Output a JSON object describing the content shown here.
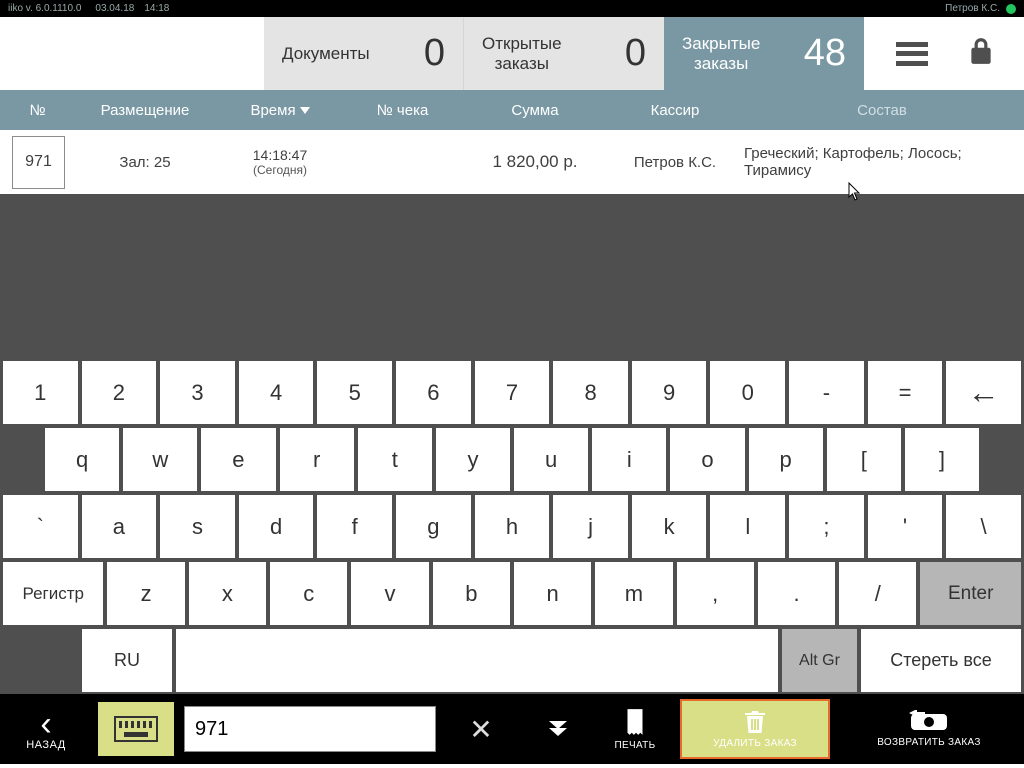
{
  "status": {
    "app": "iiko  v. 6.0.1110.0",
    "date": "03.04.18",
    "time": "14:18",
    "user": "Петров К.С."
  },
  "tabs": {
    "documents": {
      "label": "Документы",
      "count": "0"
    },
    "open": {
      "label": "Открытые\nзаказы",
      "count": "0"
    },
    "closed": {
      "label": "Закрытые\nзаказы",
      "count": "48"
    }
  },
  "columns": {
    "no": "№",
    "place": "Размещение",
    "time": "Время",
    "check": "№ чека",
    "sum": "Сумма",
    "cashier": "Кассир",
    "comp": "Состав"
  },
  "row": {
    "no": "971",
    "place": "Зал: 25",
    "time": "14:18:47",
    "time_sub": "(Сегодня)",
    "sum": "1 820,00 р.",
    "cashier": "Петров К.С.",
    "comp": "Греческий; Картофель; Лосось; Тирамису"
  },
  "keyboard": {
    "row1": [
      "1",
      "2",
      "3",
      "4",
      "5",
      "6",
      "7",
      "8",
      "9",
      "0",
      "-",
      "="
    ],
    "row2": [
      "q",
      "w",
      "e",
      "r",
      "t",
      "y",
      "u",
      "i",
      "o",
      "p",
      "[",
      "]"
    ],
    "row3": [
      "`",
      "a",
      "s",
      "d",
      "f",
      "g",
      "h",
      "j",
      "k",
      "l",
      ";",
      "'",
      "\\"
    ],
    "row4_regist": "Регистр",
    "row4": [
      "z",
      "x",
      "c",
      "v",
      "b",
      "n",
      "m",
      ",",
      ".",
      "/"
    ],
    "row4_enter": "Enter",
    "row5_lang": "RU",
    "row5_altgr": "Alt Gr",
    "row5_clear": "Стереть все"
  },
  "bottom": {
    "back": "НАЗАД",
    "search_value": "971",
    "print": "ПЕЧАТЬ",
    "delete": "УДАЛИТЬ ЗАКАЗ",
    "return": "ВОЗВРАТИТЬ ЗАКАЗ"
  }
}
